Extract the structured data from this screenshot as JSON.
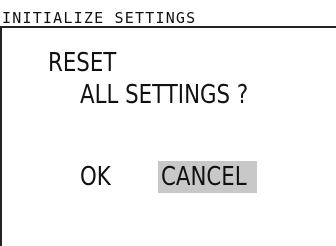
{
  "header": {
    "title": "INITIALIZE SETTINGS"
  },
  "dialog": {
    "message_line1": "RESET",
    "message_line2": "ALL SETTINGS ?"
  },
  "buttons": {
    "ok_label": "OK",
    "cancel_label": "CANCEL",
    "selected": "CANCEL"
  },
  "colors": {
    "background": "#ffffff",
    "text": "#111111",
    "selection_highlight": "#c8c8c8"
  }
}
